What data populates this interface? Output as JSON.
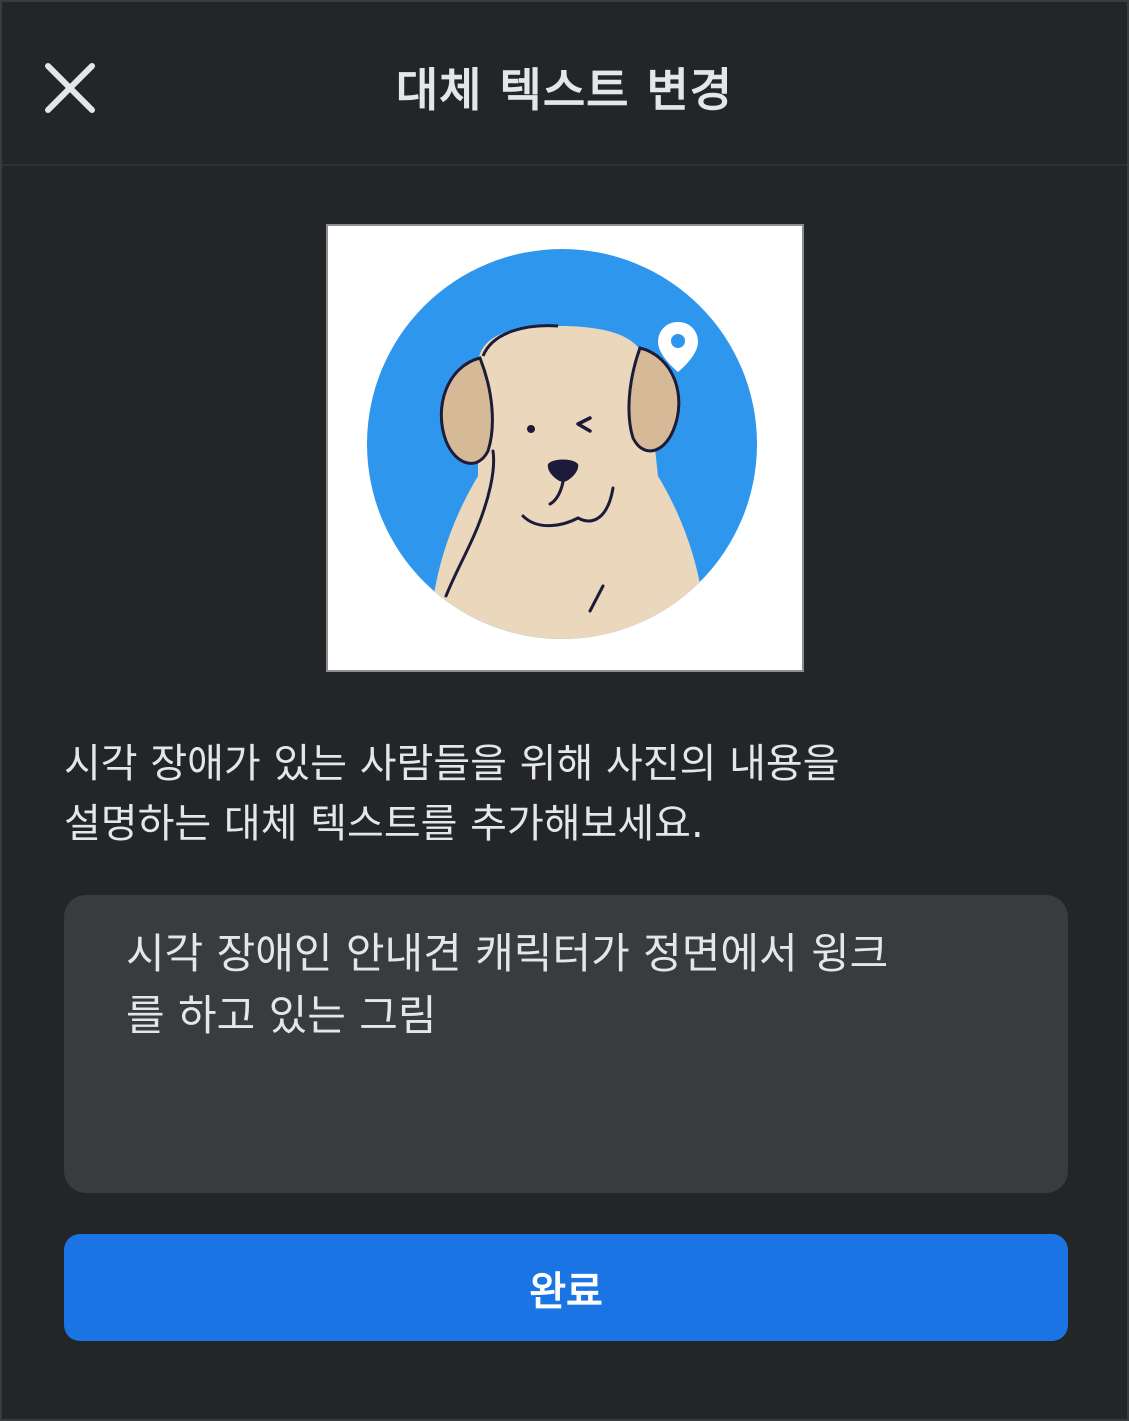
{
  "header": {
    "title": "대체 텍스트 변경",
    "close_icon": "close-icon"
  },
  "preview": {
    "image_icon": "dog-winking-illustration",
    "colors": {
      "circle": "#2f96ee",
      "fur": "#ead7bc",
      "ear": "#d6b996",
      "outline": "#1c1c3a"
    }
  },
  "description": {
    "line1": "시각 장애가 있는 사람들을 위해 사진의 내용을",
    "line2": "설명하는 대체 텍스트를 추가해보세요."
  },
  "alt_text_field": {
    "line1": "시각 장애인 안내견 캐릭터가 정면에서 윙크",
    "line2": "를 하고 있는 그림"
  },
  "done_button": {
    "label": "완료",
    "color": "#1b74e4"
  }
}
